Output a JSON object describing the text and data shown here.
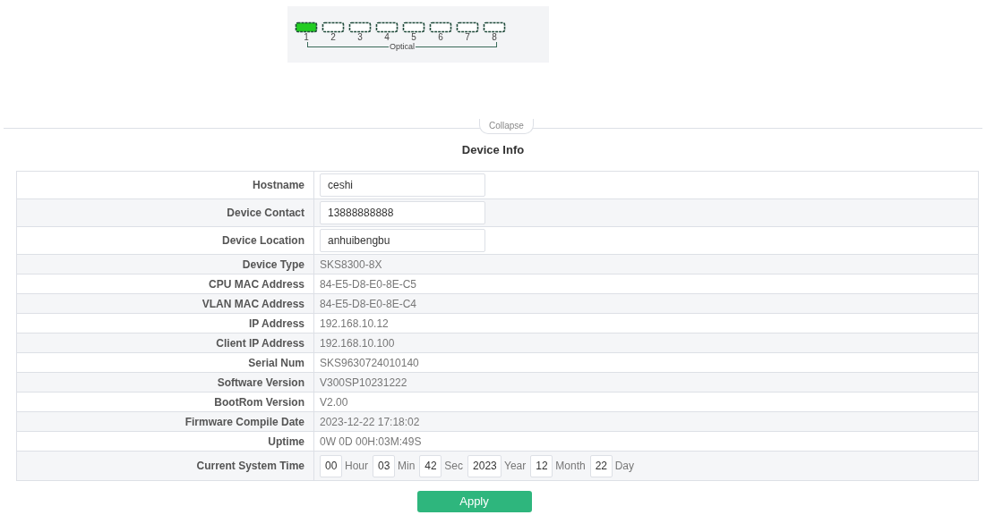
{
  "ports": [
    {
      "label": "1",
      "linked": true
    },
    {
      "label": "2",
      "linked": false
    },
    {
      "label": "3",
      "linked": false
    },
    {
      "label": "4",
      "linked": false
    },
    {
      "label": "5",
      "linked": false
    },
    {
      "label": "6",
      "linked": false
    },
    {
      "label": "7",
      "linked": false
    },
    {
      "label": "8",
      "linked": false
    }
  ],
  "port_group_label": "Optical",
  "collapse_label": "Collapse",
  "section_title": "Device Info",
  "rows": [
    {
      "kind": "input",
      "label": "Hostname",
      "value": "ceshi"
    },
    {
      "kind": "input",
      "label": "Device Contact",
      "value": "13888888888"
    },
    {
      "kind": "input",
      "label": "Device Location",
      "value": "anhuibengbu"
    },
    {
      "kind": "text",
      "label": "Device Type",
      "value": "SKS8300-8X"
    },
    {
      "kind": "text",
      "label": "CPU MAC Address",
      "value": "84-E5-D8-E0-8E-C5"
    },
    {
      "kind": "text",
      "label": "VLAN MAC Address",
      "value": "84-E5-D8-E0-8E-C4"
    },
    {
      "kind": "text",
      "label": "IP Address",
      "value": "192.168.10.12"
    },
    {
      "kind": "text",
      "label": "Client IP Address",
      "value": "192.168.10.100"
    },
    {
      "kind": "text",
      "label": "Serial Num",
      "value": "SKS9630724010140"
    },
    {
      "kind": "text",
      "label": "Software Version",
      "value": "V300SP10231222"
    },
    {
      "kind": "text",
      "label": "BootRom Version",
      "value": "V2.00"
    },
    {
      "kind": "text",
      "label": "Firmware Compile Date",
      "value": "2023-12-22 17:18:02"
    },
    {
      "kind": "text",
      "label": "Uptime",
      "value": "0W 0D 00H:03M:49S"
    },
    {
      "kind": "time",
      "label": "Current System Time",
      "parts": [
        {
          "value": "00",
          "unit": "Hour"
        },
        {
          "value": "03",
          "unit": "Min"
        },
        {
          "value": "42",
          "unit": "Sec"
        },
        {
          "value": "2023",
          "unit": "Year"
        },
        {
          "value": "12",
          "unit": "Month"
        },
        {
          "value": "22",
          "unit": "Day"
        }
      ]
    }
  ],
  "apply_label": "Apply"
}
